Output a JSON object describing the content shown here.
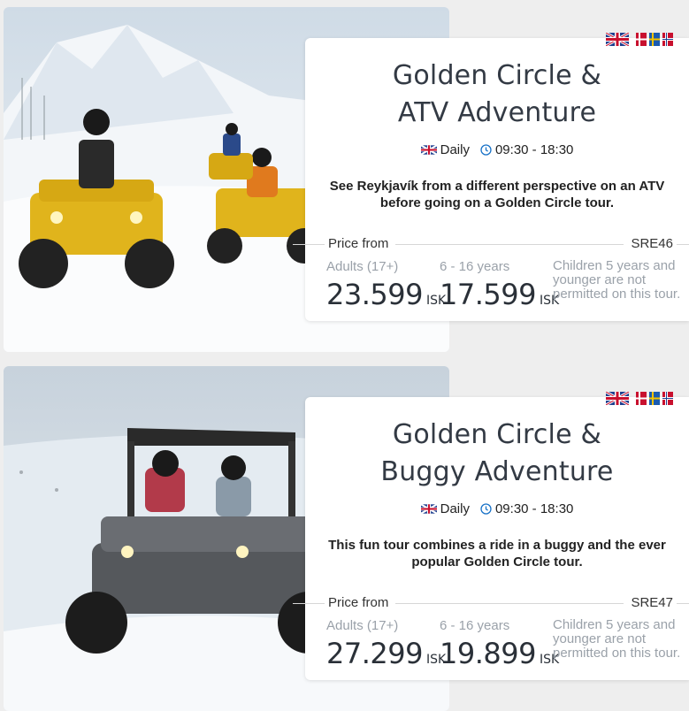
{
  "tours": [
    {
      "title_line1": "Golden Circle &",
      "title_line2": "ATV Adventure",
      "frequency": "Daily",
      "time": "09:30 - 18:30",
      "description": "See Reykjavík from a different perspective on an ATV before going on a Golden Circle tour.",
      "price_from_label": "Price from",
      "code": "SRE46",
      "adult_label": "Adults (17+)",
      "adult_price": "23.599",
      "child_label": "6 - 16 years",
      "child_price": "17.599",
      "currency": "ISK",
      "note": "Children 5 years and younger are not permitted on this tour."
    },
    {
      "title_line1": "Golden Circle &",
      "title_line2": "Buggy Adventure",
      "frequency": "Daily",
      "time": "09:30 - 18:30",
      "description": "This fun tour combines a ride in a buggy and the ever popular Golden Circle tour.",
      "price_from_label": "Price from",
      "code": "SRE47",
      "adult_label": "Adults (17+)",
      "adult_price": "27.299",
      "child_label": "6 - 16 years",
      "child_price": "19.899",
      "currency": "ISK",
      "note": "Children 5 years and younger are not permitted on this tour."
    }
  ],
  "icons": {
    "language_flags": [
      "uk-flag-icon",
      "scandinavian-flags-icon"
    ],
    "clock": "clock-icon"
  },
  "colors": {
    "accent_blue": "#1a73c8",
    "card_bg": "#ffffff",
    "title": "#333a44",
    "muted": "#9aa1a9"
  }
}
